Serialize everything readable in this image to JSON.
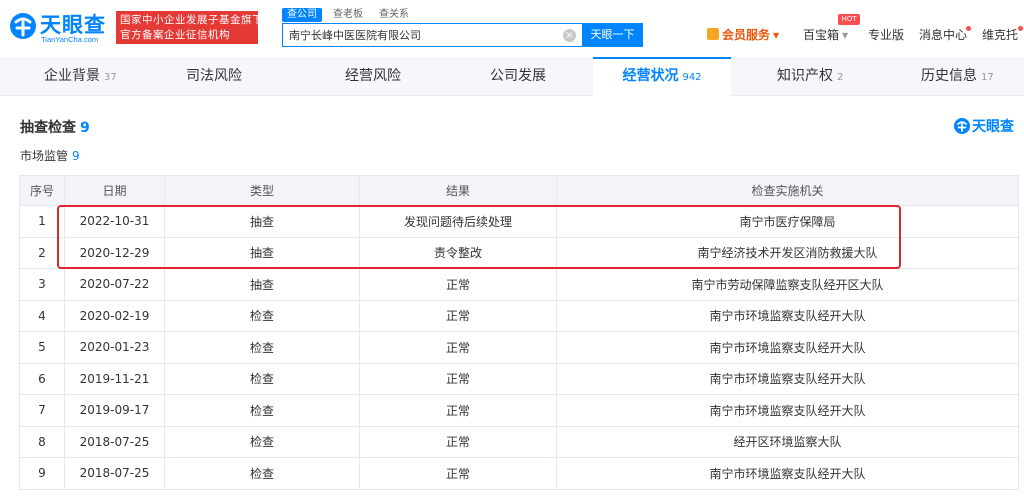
{
  "header": {
    "logo_cn": "天眼查",
    "logo_en": "TianYanCha.com",
    "banner_line1": "国家中小企业发展子基金旗下",
    "banner_line2": "官方备案企业征信机构",
    "search_tabs": [
      "查公司",
      "查老板",
      "查关系"
    ],
    "search_value": "南宁长峰中医医院有限公司",
    "search_button": "天眼一下",
    "vip_label": "会员服务",
    "treasure_label": "百宝箱",
    "hot_badge": "HOT",
    "pro_label": "专业版",
    "message_label": "消息中心",
    "user_label": "维克托"
  },
  "tabs": [
    {
      "label": "企业背景",
      "count": "37"
    },
    {
      "label": "司法风险",
      "count": ""
    },
    {
      "label": "经营风险",
      "count": ""
    },
    {
      "label": "公司发展",
      "count": ""
    },
    {
      "label": "经营状况",
      "count": "942"
    },
    {
      "label": "知识产权",
      "count": "2"
    },
    {
      "label": "历史信息",
      "count": "17"
    }
  ],
  "section": {
    "title": "抽查检查",
    "count": "9",
    "subtitle": "市场监管",
    "sub_count": "9",
    "brand": "天眼查"
  },
  "table": {
    "columns": [
      "序号",
      "日期",
      "类型",
      "结果",
      "检查实施机关"
    ],
    "rows": [
      {
        "no": "1",
        "date": "2022-10-31",
        "type": "抽查",
        "result": "发现问题待后续处理",
        "org": "南宁市医疗保障局"
      },
      {
        "no": "2",
        "date": "2020-12-29",
        "type": "抽查",
        "result": "责令整改",
        "org": "南宁经济技术开发区消防救援大队"
      },
      {
        "no": "3",
        "date": "2020-07-22",
        "type": "抽查",
        "result": "正常",
        "org": "南宁市劳动保障监察支队经开区大队"
      },
      {
        "no": "4",
        "date": "2020-02-19",
        "type": "检查",
        "result": "正常",
        "org": "南宁市环境监察支队经开大队"
      },
      {
        "no": "5",
        "date": "2020-01-23",
        "type": "检查",
        "result": "正常",
        "org": "南宁市环境监察支队经开大队"
      },
      {
        "no": "6",
        "date": "2019-11-21",
        "type": "检查",
        "result": "正常",
        "org": "南宁市环境监察支队经开大队"
      },
      {
        "no": "7",
        "date": "2019-09-17",
        "type": "检查",
        "result": "正常",
        "org": "南宁市环境监察支队经开大队"
      },
      {
        "no": "8",
        "date": "2018-07-25",
        "type": "检查",
        "result": "正常",
        "org": "经开区环境监察大队"
      },
      {
        "no": "9",
        "date": "2018-07-25",
        "type": "检查",
        "result": "正常",
        "org": "南宁市环境监察支队经开大队"
      }
    ]
  },
  "colors": {
    "accent": "#0084ff",
    "banner": "#e53935",
    "highlight": "#e0262e"
  }
}
